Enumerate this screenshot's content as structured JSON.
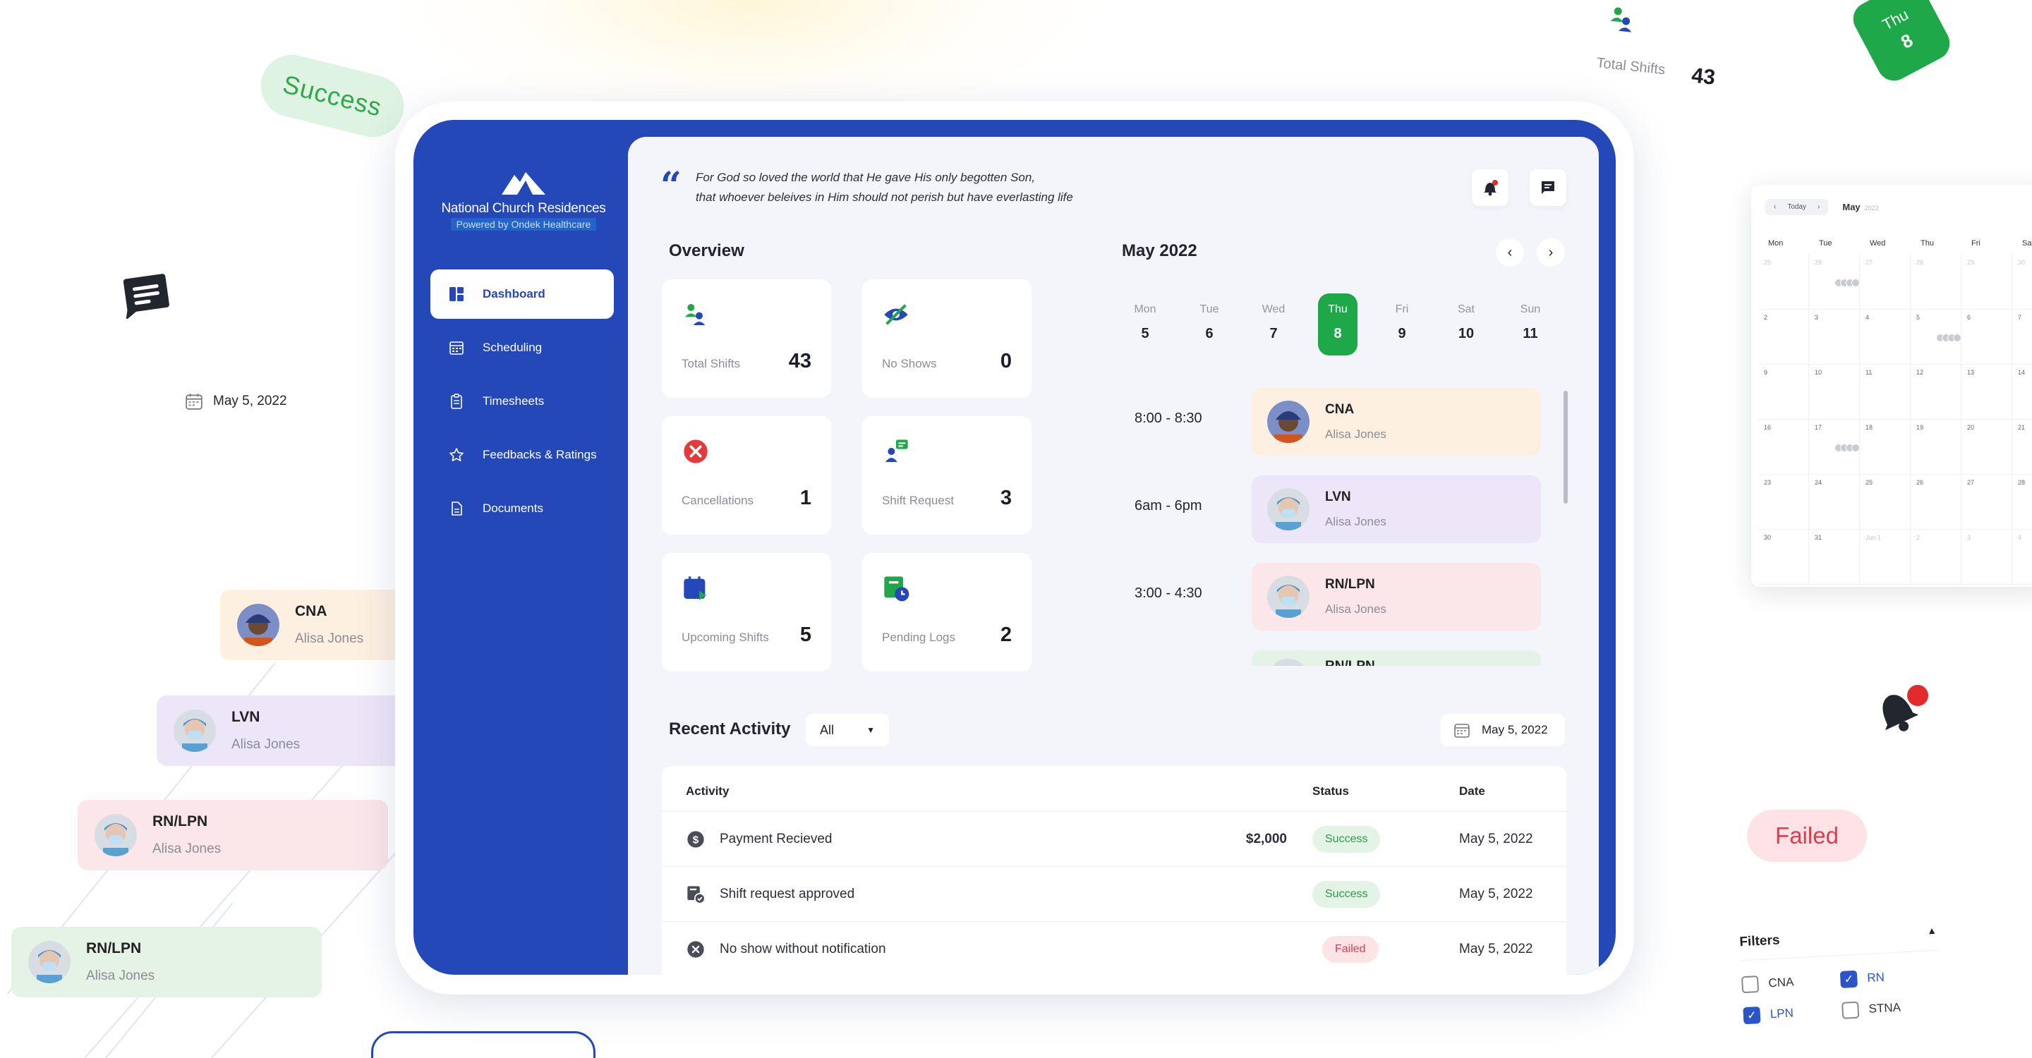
{
  "theme": {
    "primary": "#2448b7",
    "green": "#1ea84a",
    "red": "#e23b4c"
  },
  "decor": {
    "success_pill": "Success",
    "date": "May 5, 2022",
    "float_cards": [
      {
        "role": "CNA",
        "name": "Alisa Jones",
        "bg": "#fdf0e0"
      },
      {
        "role": "LVN",
        "name": "Alisa Jones",
        "bg": "#ede6f8"
      },
      {
        "role": "RN/LPN",
        "name": "Alisa Jones",
        "bg": "#fbe6ea"
      },
      {
        "role": "RN/LPN",
        "name": "Alisa Jones",
        "bg": "#e5f3e6"
      }
    ],
    "total_shifts": {
      "label": "Total Shifts",
      "value": "43"
    },
    "thu_tag": {
      "day": "Thu",
      "date": "8"
    },
    "calendar": {
      "nav_today": "Today",
      "month": "May",
      "year": "2022",
      "weekdays": [
        "Mon",
        "Tue",
        "Wed",
        "Thu",
        "Fri",
        "Sat"
      ],
      "rows": [
        [
          "25",
          "26",
          "27",
          "28",
          "29",
          "30"
        ],
        [
          "2",
          "3",
          "4",
          "5",
          "6",
          "7"
        ],
        [
          "9",
          "10",
          "11",
          "12",
          "13",
          "14"
        ],
        [
          "16",
          "17",
          "18",
          "19",
          "20",
          "21"
        ],
        [
          "23",
          "24",
          "25",
          "26",
          "27",
          "28"
        ],
        [
          "30",
          "31",
          "Jun 1",
          "2",
          "3",
          "4"
        ]
      ]
    },
    "failed_pill": "Failed",
    "filters": {
      "title": "Filters",
      "options": [
        {
          "label": "CNA",
          "checked": false
        },
        {
          "label": "RN",
          "checked": true
        },
        {
          "label": "LPN",
          "checked": true
        },
        {
          "label": "STNA",
          "checked": false
        }
      ]
    }
  },
  "sidebar": {
    "org_name": "National Church Residences",
    "powered_by": "Powered by Ondek Healthcare",
    "items": [
      {
        "label": "Dashboard",
        "icon": "dashboard-icon",
        "active": true
      },
      {
        "label": "Scheduling",
        "icon": "calendar-icon",
        "active": false
      },
      {
        "label": "Timesheets",
        "icon": "clipboard-icon",
        "active": false
      },
      {
        "label": "Feedbacks & Ratings",
        "icon": "star-icon",
        "active": false
      },
      {
        "label": "Documents",
        "icon": "document-icon",
        "active": false
      }
    ]
  },
  "header": {
    "quote_line1": "For God so loved the world that He gave His only begotten Son,",
    "quote_line2": "that whoever beleives in Him should not perish but have everlasting life"
  },
  "overview": {
    "title": "Overview",
    "stats": [
      {
        "label": "Total Shifts",
        "value": "43",
        "icon": "users-icon"
      },
      {
        "label": "No Shows",
        "value": "0",
        "icon": "eye-off-icon"
      },
      {
        "label": "Cancellations",
        "value": "1",
        "icon": "cancel-icon"
      },
      {
        "label": "Shift Request",
        "value": "3",
        "icon": "user-request-icon"
      },
      {
        "label": "Upcoming Shifts",
        "value": "5",
        "icon": "calendar-arrow-icon"
      },
      {
        "label": "Pending Logs",
        "value": "2",
        "icon": "pending-log-icon"
      }
    ]
  },
  "schedule": {
    "title": "May 2022",
    "days": [
      {
        "name": "Mon",
        "date": "5"
      },
      {
        "name": "Tue",
        "date": "6"
      },
      {
        "name": "Wed",
        "date": "7"
      },
      {
        "name": "Thu",
        "date": "8",
        "active": true
      },
      {
        "name": "Fri",
        "date": "9"
      },
      {
        "name": "Sat",
        "date": "10"
      },
      {
        "name": "Sun",
        "date": "11"
      }
    ],
    "shifts": [
      {
        "time": "8:00 - 8:30",
        "role": "CNA",
        "name": "Alisa Jones",
        "bg": "#fdf0e0"
      },
      {
        "time": "6am - 6pm",
        "role": "LVN",
        "name": "Alisa Jones",
        "bg": "#ede6f8"
      },
      {
        "time": "3:00 - 4:30",
        "role": "RN/LPN",
        "name": "Alisa Jones",
        "bg": "#fbe6ea"
      },
      {
        "time": "",
        "role": "RN/LPN",
        "name": "Alisa Jones",
        "bg": "#e5f3e6"
      }
    ]
  },
  "activity": {
    "title": "Recent Activity",
    "filter_value": "All",
    "date": "May 5, 2022",
    "columns": {
      "activity": "Activity",
      "status": "Status",
      "date": "Date"
    },
    "rows": [
      {
        "activity": "Payment Recieved",
        "amount": "$2,000",
        "status": "Success",
        "kind": "success",
        "date": "May 5, 2022",
        "icon": "dollar-icon"
      },
      {
        "activity": "Shift request approved",
        "amount": "",
        "status": "Success",
        "kind": "success",
        "date": "May 5, 2022",
        "icon": "shift-approved-icon"
      },
      {
        "activity": "No show without notification",
        "amount": "",
        "status": "Failed",
        "kind": "failed",
        "date": "May 5, 2022",
        "icon": "x-circle-icon"
      }
    ]
  }
}
